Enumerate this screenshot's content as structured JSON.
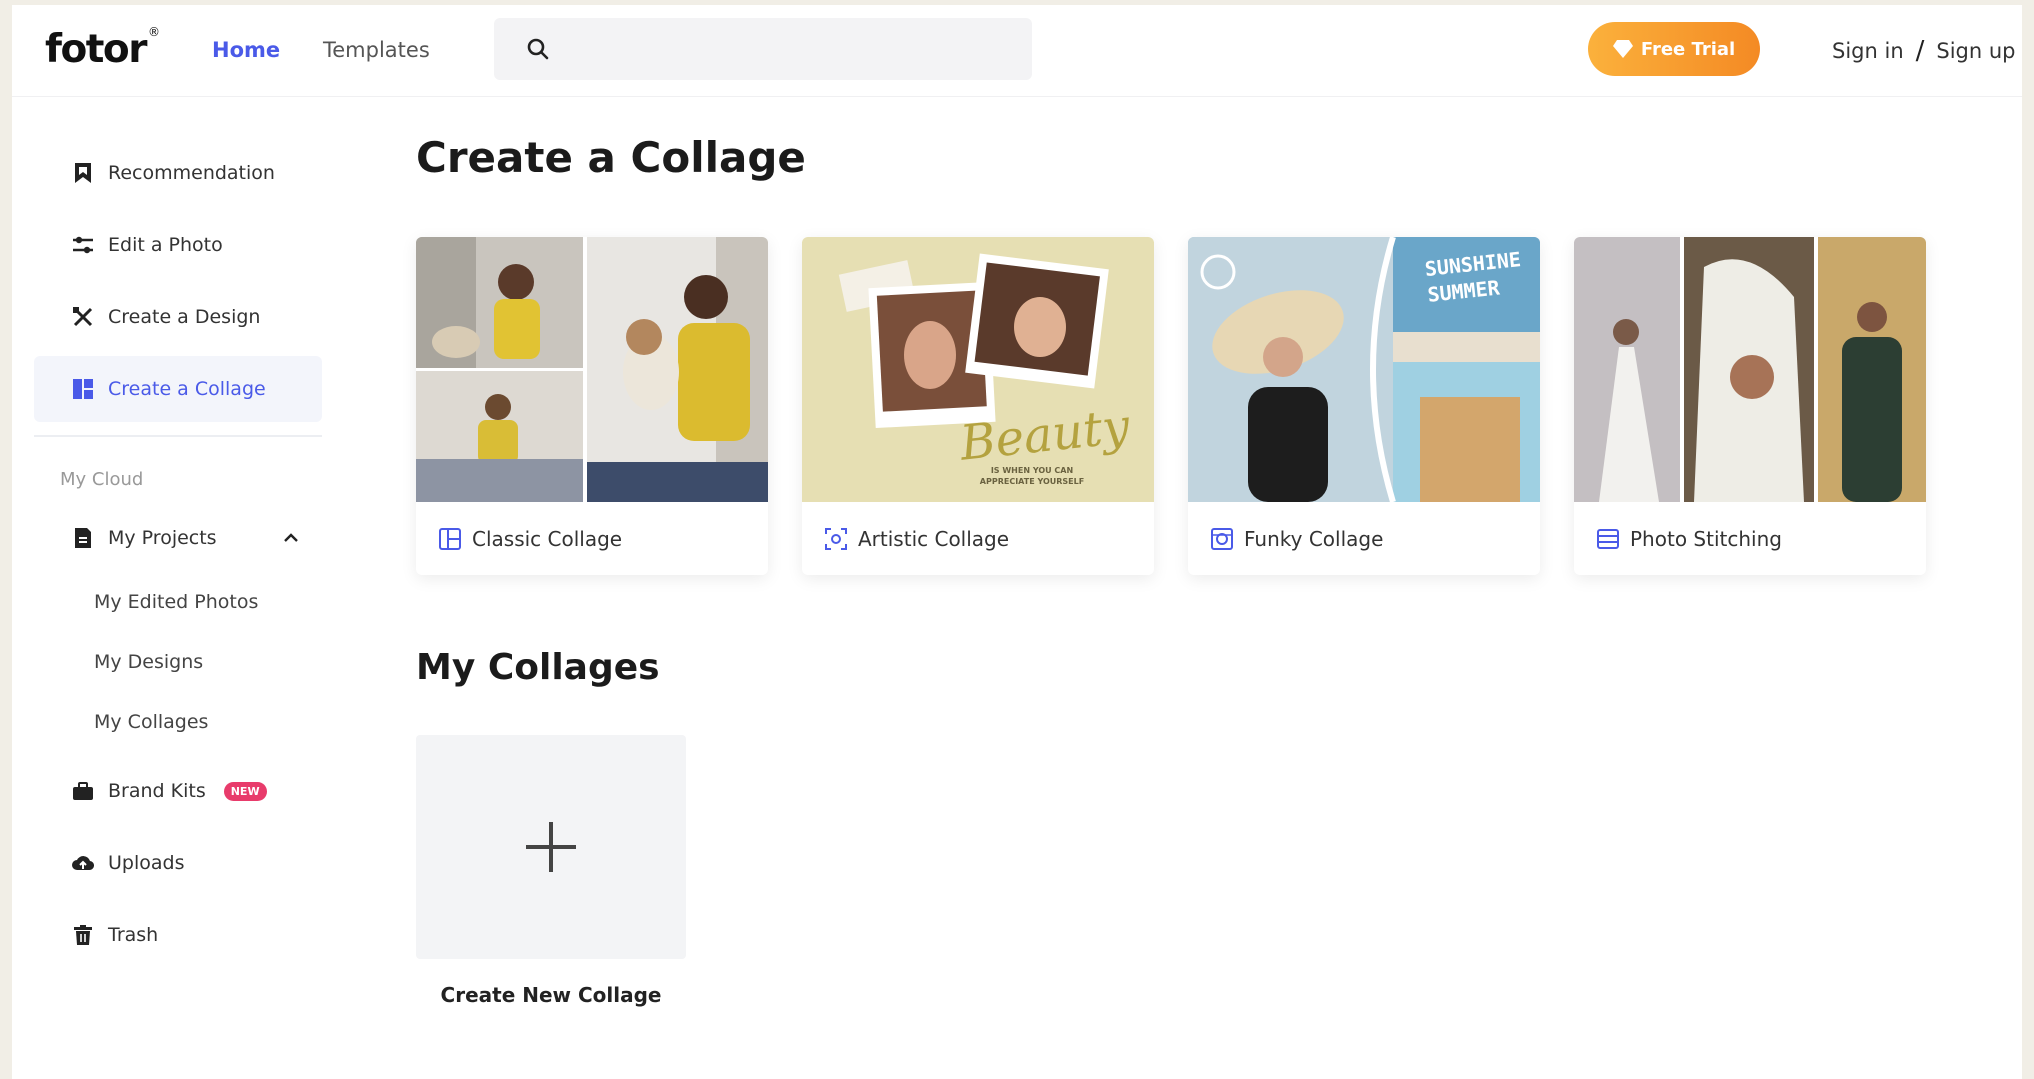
{
  "header": {
    "logo": "fotor",
    "logo_mark": "®",
    "nav": {
      "home": "Home",
      "templates": "Templates"
    },
    "search_placeholder": "",
    "free_trial": "Free Trial",
    "sign_in": "Sign in",
    "separator": "/",
    "sign_up": "Sign up"
  },
  "sidebar": {
    "items": [
      {
        "label": "Recommendation",
        "icon": "bookmark-icon"
      },
      {
        "label": "Edit a Photo",
        "icon": "sliders-icon"
      },
      {
        "label": "Create a Design",
        "icon": "design-tools-icon"
      },
      {
        "label": "Create a Collage",
        "icon": "collage-icon",
        "active": true
      }
    ],
    "cloud_label": "My Cloud",
    "my_projects": "My Projects",
    "sub_items": [
      "My Edited Photos",
      "My Designs",
      "My Collages"
    ],
    "brand_kits": "Brand Kits",
    "new_badge": "NEW",
    "uploads": "Uploads",
    "trash": "Trash"
  },
  "main": {
    "title": "Create a Collage",
    "cards": [
      {
        "label": "Classic Collage",
        "icon": "classic-collage-icon"
      },
      {
        "label": "Artistic Collage",
        "icon": "artistic-collage-icon"
      },
      {
        "label": "Funky Collage",
        "icon": "funky-collage-icon"
      },
      {
        "label": "Photo Stitching",
        "icon": "photo-stitching-icon"
      }
    ],
    "artistic_text": {
      "script": "Beauty",
      "tagline_1": "IS WHEN YOU CAN",
      "tagline_2": "APPRECIATE YOURSELF"
    },
    "funky_text": {
      "line1": "SUNSHINE",
      "line2": "SUMMER"
    },
    "my_collages_title": "My Collages",
    "create_new": "Create New Collage"
  },
  "colors": {
    "accent": "#4a5ae8",
    "trial_start": "#fbb13c",
    "trial_end": "#f48a24",
    "badge": "#e83b6b",
    "page_bg": "#f1eee6"
  }
}
